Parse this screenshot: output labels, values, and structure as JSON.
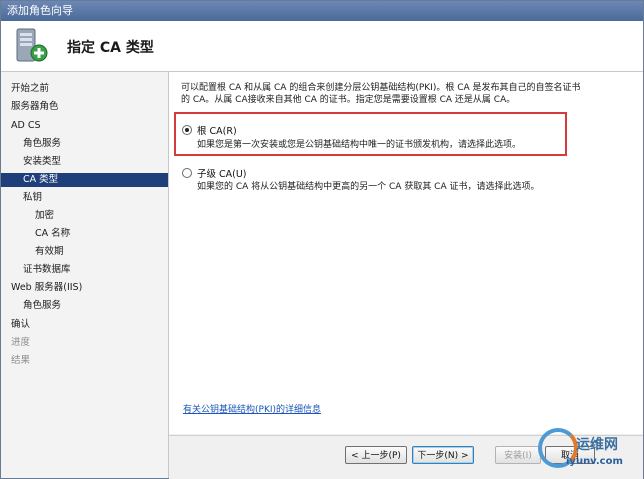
{
  "window": {
    "title": "添加角色向导"
  },
  "banner": {
    "title": "指定 CA 类型",
    "icon": "server-wizard-icon"
  },
  "sidebar": {
    "items": [
      {
        "label": "开始之前",
        "state": "normal"
      },
      {
        "label": "服务器角色",
        "state": "normal"
      },
      {
        "label": "AD CS",
        "state": "normal"
      },
      {
        "label": "角色服务",
        "state": "normal"
      },
      {
        "label": "安装类型",
        "state": "normal"
      },
      {
        "label": "CA 类型",
        "state": "active"
      },
      {
        "label": "私钥",
        "state": "normal"
      },
      {
        "label": "加密",
        "state": "normal"
      },
      {
        "label": "CA 名称",
        "state": "normal"
      },
      {
        "label": "有效期",
        "state": "normal"
      },
      {
        "label": "证书数据库",
        "state": "normal"
      },
      {
        "label": "Web 服务器(IIS)",
        "state": "normal"
      },
      {
        "label": "角色服务",
        "state": "normal"
      },
      {
        "label": "确认",
        "state": "normal"
      },
      {
        "label": "进度",
        "state": "disabled"
      },
      {
        "label": "结果",
        "state": "disabled"
      }
    ]
  },
  "main": {
    "intro_line1": "可以配置根 CA 和从属 CA 的组合来创建分层公钥基础结构(PKI)。根 CA 是发布其自己的自签名证书",
    "intro_line2": "的 CA。从属 CA接收来自其他 CA 的证书。指定您是需要设置根 CA 还是从属 CA。",
    "options": [
      {
        "label": "根 CA(R)",
        "description": "如果您是第一次安装或您是公钥基础结构中唯一的证书颁发机构，请选择此选项。",
        "selected": true
      },
      {
        "label": "子级 CA(U)",
        "description": "如果您的 CA 将从公钥基础结构中更高的另一个 CA 获取其 CA 证书，请选择此选项。",
        "selected": false
      }
    ],
    "link": "有关公钥基础结构(PKI)的详细信息"
  },
  "buttons": {
    "back": "< 上一步(P)",
    "next": "下一步(N) >",
    "install": "安装(I)",
    "cancel": "取消"
  },
  "watermark": {
    "title": "运维网",
    "url": "iyunv.com"
  }
}
